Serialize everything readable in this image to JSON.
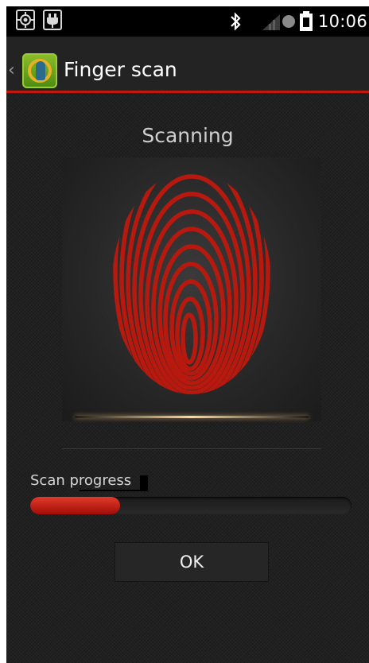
{
  "status_bar": {
    "time": "10:06",
    "icons": [
      "gps-icon",
      "usb-icon",
      "bluetooth-icon",
      "signal-icon",
      "record-icon",
      "battery-icon"
    ]
  },
  "header": {
    "title": "Finger scan",
    "back_icon": "chevron-left-icon",
    "app_icon": "app-logo-icon",
    "accent_color": "#c01a10"
  },
  "main": {
    "scan_status": "Scanning",
    "fingerprint_icon": "fingerprint-icon",
    "progress_label": "Scan progress",
    "progress_fraction": 0.28,
    "ok_label": "OK"
  }
}
